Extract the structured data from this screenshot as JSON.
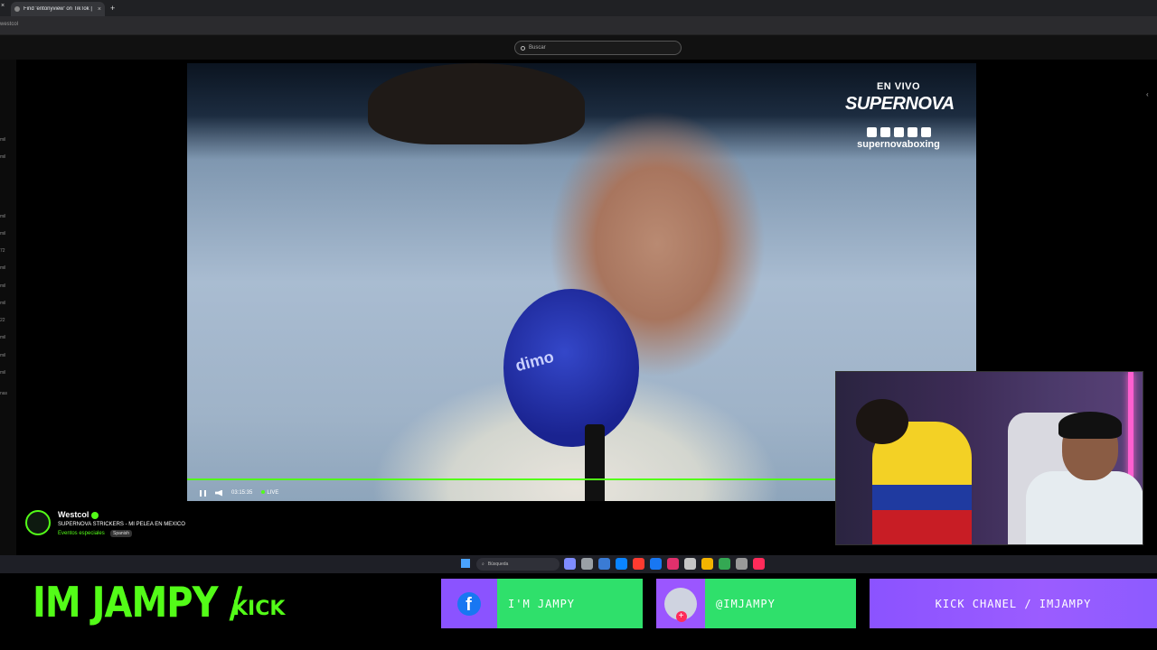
{
  "browser": {
    "tab_title": "Find 'entonyview' on TikTok | T",
    "tab_close": "×",
    "new_tab": "+",
    "address_text": "westcol"
  },
  "site": {
    "search_placeholder": "Buscar"
  },
  "left_rail": [
    "mil",
    "mil",
    "mil",
    "mil",
    "72",
    "mil",
    "mil",
    "mil",
    "22",
    "mil",
    "mil",
    "mil",
    "nas"
  ],
  "video": {
    "mic_brand": "dimo",
    "overlay": {
      "live_label": "EN VIVO",
      "brand": "SUPERNOVA",
      "handle": "supernovaboxing"
    },
    "elapsed": "03:15:35",
    "live_badge": "LIVE"
  },
  "stream": {
    "streamer": "Westcol",
    "title": "SUPERNOVA STRICKERS - MI PELEA EN MEXICO",
    "category": "Eventos especiales",
    "language": "Spanish"
  },
  "taskbar": {
    "search_label": "Búsqueda",
    "icon_colors": [
      "#7f8cff",
      "#9aa0a6",
      "#3a7bd5",
      "#0a84ff",
      "#ff3b30",
      "#1877f2",
      "#e1306c",
      "#c6c6c6",
      "#f4b400",
      "#34a853",
      "#999999",
      "#ff2b5a"
    ]
  },
  "banner": {
    "name": "IM JAMPY /",
    "platform": "KICK",
    "facebook_label": "I'M JAMPY",
    "instagram_label": "@IMJAMPY",
    "kick_label": "KICK CHANEL / IMJAMPY",
    "accent_green": "#53fc18",
    "accent_purple": "#8b53ff"
  }
}
